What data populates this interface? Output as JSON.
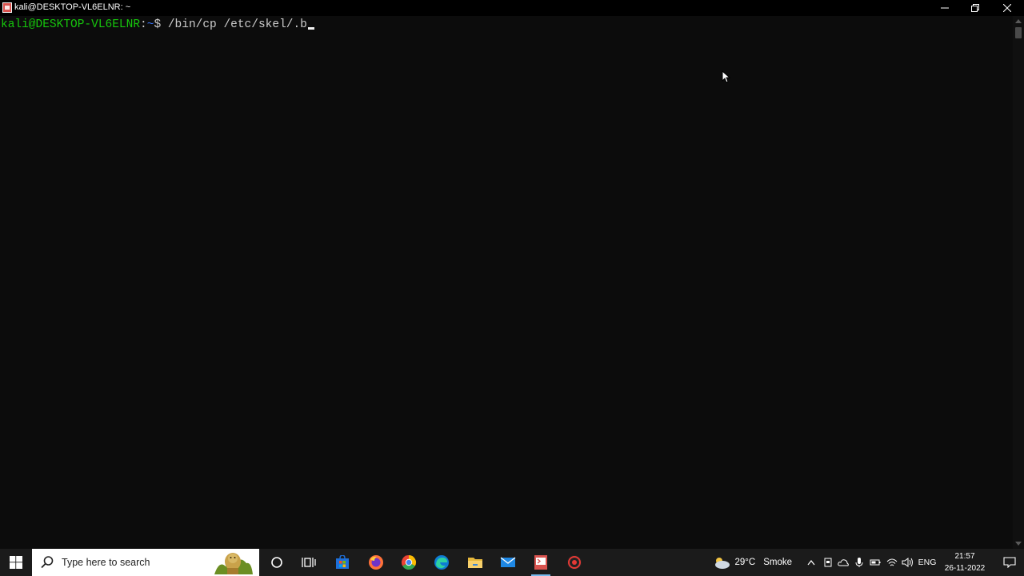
{
  "window": {
    "title": "kali@DESKTOP-VL6ELNR: ~"
  },
  "terminal": {
    "prompt_user": "kali@DESKTOP-VL6ELNR",
    "prompt_sep": ":",
    "prompt_path": "~",
    "prompt_symbol": "$ ",
    "command": "/bin/cp /etc/skel/.b"
  },
  "taskbar": {
    "search_placeholder": "Type here to search",
    "pinned": [
      "cortana-icon",
      "task-view-icon",
      "store-icon",
      "firefox-icon",
      "chrome-icon",
      "edge-icon",
      "file-explorer-icon",
      "mail-icon",
      "kali-terminal-icon",
      "app-icon"
    ],
    "weather": {
      "temperature": "29°C",
      "condition": "Smoke"
    },
    "language": "ENG",
    "time": "21:57",
    "date": "26-11-2022"
  },
  "colors": {
    "terminal_bg": "#0c0c0c",
    "prompt_green": "#16c60c",
    "prompt_blue": "#3b78ff",
    "taskbar_bg": "#1b1b1b"
  }
}
